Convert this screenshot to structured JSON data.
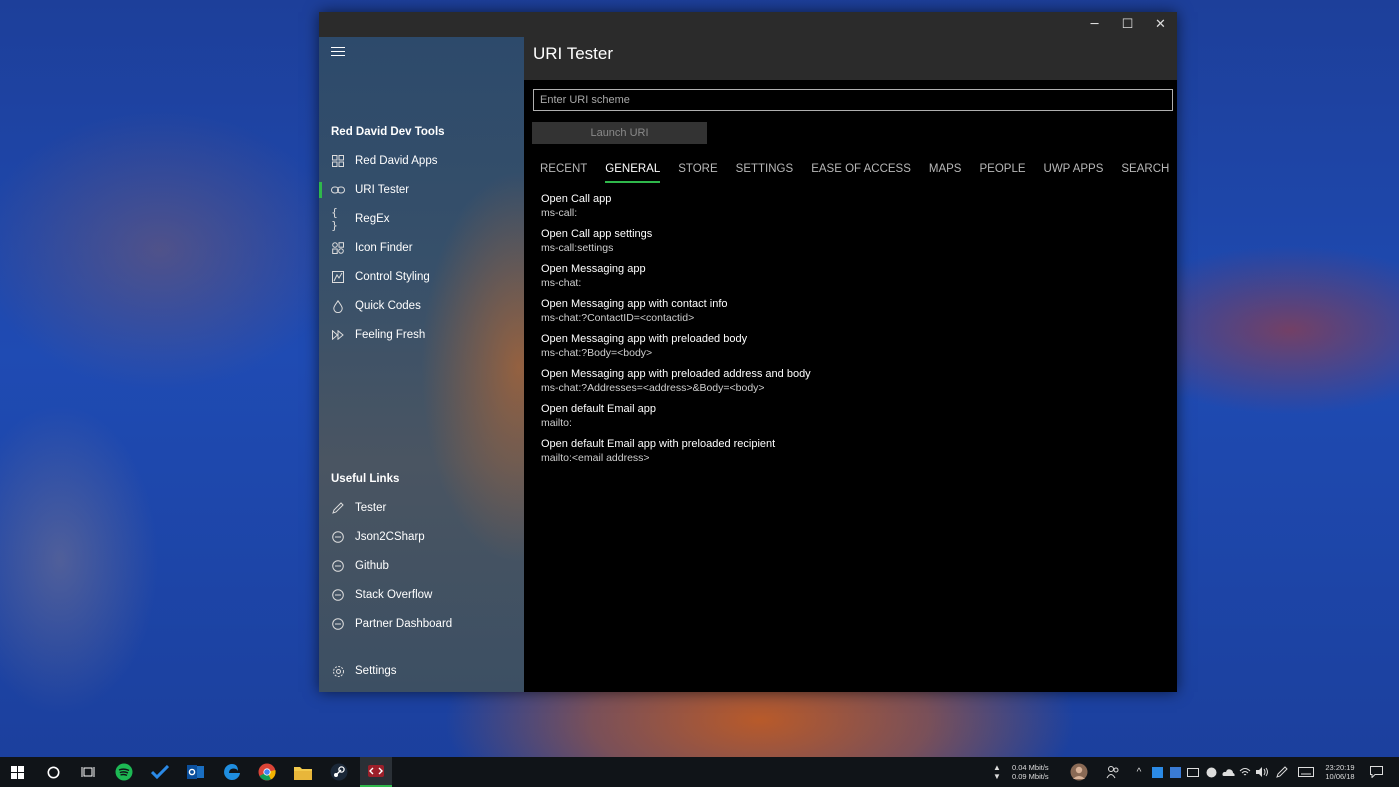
{
  "window": {
    "title_bar": {
      "minimize_label": "─",
      "maximize_label": "☐",
      "close_label": "✕"
    }
  },
  "sidebar": {
    "section_title": "Red David Dev Tools",
    "items": [
      {
        "label": "Red David Apps",
        "icon": "apps-icon"
      },
      {
        "label": "URI Tester",
        "icon": "link-icon",
        "selected": true
      },
      {
        "label": "RegEx",
        "icon": "braces-icon"
      },
      {
        "label": "Icon Finder",
        "icon": "icon-finder-icon"
      },
      {
        "label": "Control Styling",
        "icon": "styling-icon"
      },
      {
        "label": "Quick Codes",
        "icon": "drop-icon"
      },
      {
        "label": "Feeling Fresh",
        "icon": "fast-forward-icon"
      }
    ],
    "links_title": "Useful Links",
    "links": [
      {
        "label": "Tester",
        "icon": "pen-icon"
      },
      {
        "label": "Json2CSharp",
        "icon": "globe-icon"
      },
      {
        "label": "Github",
        "icon": "globe-icon"
      },
      {
        "label": "Stack Overflow",
        "icon": "globe-icon"
      },
      {
        "label": "Partner Dashboard",
        "icon": "globe-icon"
      }
    ],
    "settings_label": "Settings"
  },
  "header": {
    "title": "URI Tester"
  },
  "uri_input": {
    "placeholder": "Enter URI scheme",
    "value": ""
  },
  "launch_button": {
    "label": "Launch URI"
  },
  "tabs": [
    {
      "label": "RECENT"
    },
    {
      "label": "GENERAL",
      "active": true
    },
    {
      "label": "STORE"
    },
    {
      "label": "SETTINGS"
    },
    {
      "label": "EASE OF ACCESS"
    },
    {
      "label": "MAPS"
    },
    {
      "label": "PEOPLE"
    },
    {
      "label": "UWP APPS"
    },
    {
      "label": "SEARCH"
    }
  ],
  "uri_list": [
    {
      "title": "Open Call app",
      "uri": "ms-call:"
    },
    {
      "title": "Open Call app settings",
      "uri": "ms-call:settings"
    },
    {
      "title": "Open Messaging app",
      "uri": "ms-chat:"
    },
    {
      "title": "Open Messaging app with contact info",
      "uri": "ms-chat:?ContactID=<contactid>"
    },
    {
      "title": "Open Messaging app with preloaded body",
      "uri": "ms-chat:?Body=<body>"
    },
    {
      "title": "Open Messaging app with preloaded address and body",
      "uri": "ms-chat:?Addresses=<address>&Body=<body>"
    },
    {
      "title": "Open default Email app",
      "uri": "mailto:"
    },
    {
      "title": "Open default Email app with preloaded recipient",
      "uri": "mailto:<email address>"
    }
  ],
  "taskbar": {
    "net_up": "0.04 Mbit/s",
    "net_down": "0.09 Mbit/s",
    "time": "23:20:19",
    "date": "10/06/18"
  },
  "colors": {
    "accent": "#2fb84b",
    "header_bg": "#2b2b2b",
    "content_bg": "#000000"
  }
}
